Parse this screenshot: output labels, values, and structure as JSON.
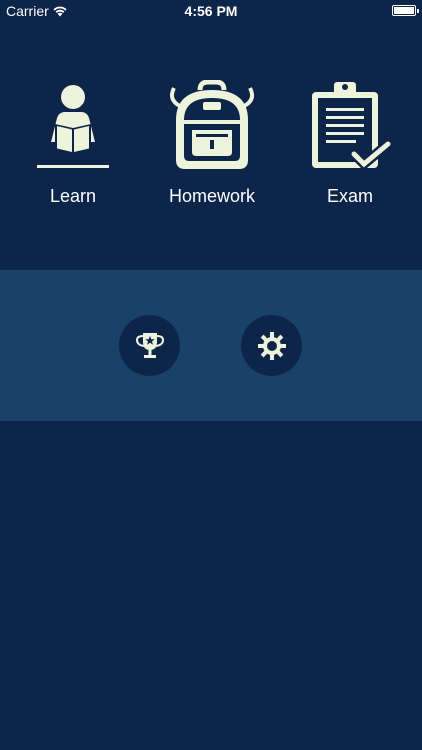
{
  "status_bar": {
    "carrier": "Carrier",
    "time": "4:56 PM",
    "wifi_icon": "wifi-icon",
    "battery_icon": "battery-icon",
    "battery_level": 1.0
  },
  "menu": {
    "items": [
      {
        "label": "Learn",
        "icon": "reading-person-icon"
      },
      {
        "label": "Homework",
        "icon": "backpack-icon"
      },
      {
        "label": "Exam",
        "icon": "clipboard-check-icon"
      }
    ]
  },
  "actions": {
    "items": [
      {
        "icon": "trophy-icon"
      },
      {
        "icon": "gear-icon"
      }
    ]
  },
  "colors": {
    "background": "#0d2549",
    "band": "#1a416a",
    "icon": "#eef3dc",
    "text": "#ffffff"
  }
}
